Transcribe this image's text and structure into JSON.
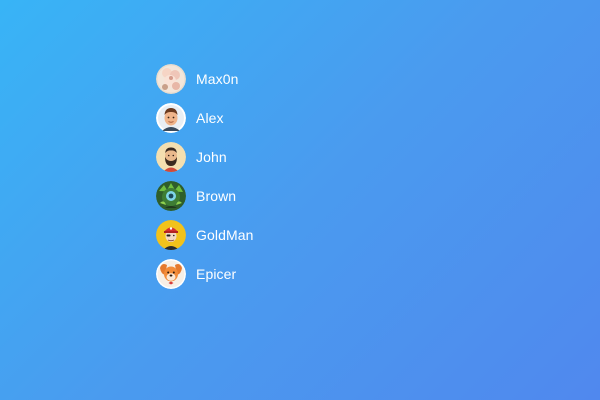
{
  "users": [
    {
      "name": "Max0n",
      "avatar_icon": "flower-photo-avatar-icon"
    },
    {
      "name": "Alex",
      "avatar_icon": "man-cartoon-avatar-icon"
    },
    {
      "name": "John",
      "avatar_icon": "bearded-man-avatar-icon"
    },
    {
      "name": "Brown",
      "avatar_icon": "green-monster-avatar-icon"
    },
    {
      "name": "GoldMan",
      "avatar_icon": "pirate-avatar-icon"
    },
    {
      "name": "Epicer",
      "avatar_icon": "dog-avatar-icon"
    }
  ],
  "colors": {
    "background_start": "#38b4f6",
    "background_end": "#5088ee",
    "text": "#ffffff"
  }
}
